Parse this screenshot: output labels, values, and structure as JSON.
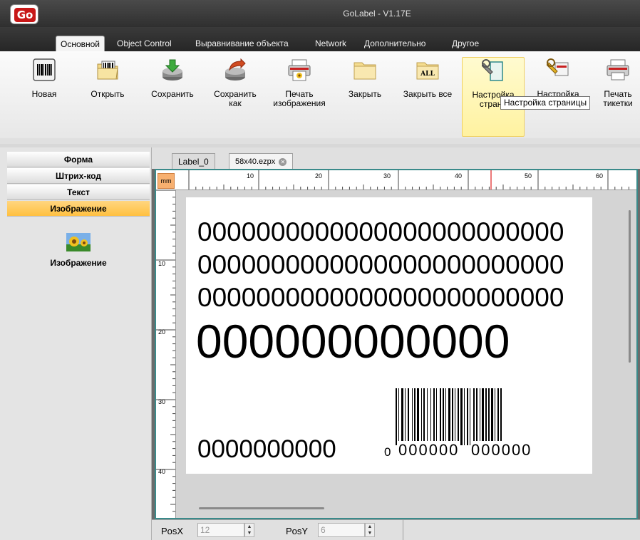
{
  "app": {
    "title": "GoLabel - V1.17E",
    "logo_text": "Go"
  },
  "ribbon_tabs": [
    "Основной",
    "Object Control",
    "Выравнивание объекта",
    "Network",
    "Дополнительно",
    "Другое"
  ],
  "ribbon_buttons": [
    {
      "label": "Новая",
      "icon": "barcode-doc-icon"
    },
    {
      "label": "Открыть",
      "icon": "open-folder-icon"
    },
    {
      "label": "Сохранить",
      "icon": "save-icon"
    },
    {
      "label": "Сохранить как",
      "icon": "save-as-icon"
    },
    {
      "label": "Печать изображения",
      "icon": "print-image-icon"
    },
    {
      "label": "Закрыть",
      "icon": "folder-icon"
    },
    {
      "label": "Закрыть все",
      "icon": "close-all-icon"
    },
    {
      "label": "Настройка страни",
      "icon": "page-setup-icon"
    },
    {
      "label": "Настройка",
      "icon": "settings-icon"
    },
    {
      "label": "Печать тикетки",
      "icon": "print-label-icon"
    }
  ],
  "tooltip": "Настройка страницы",
  "left_panel": {
    "sections": [
      "Форма",
      "Штрих-код",
      "Текст",
      "Изображение"
    ],
    "active_section": "Изображение",
    "item_label": "Изображение"
  },
  "doc_tabs": [
    "Label_0",
    "58x40.ezpx"
  ],
  "ruler": {
    "unit": "mm",
    "h_ticks": [
      "10",
      "20",
      "30",
      "40",
      "50",
      "60"
    ],
    "v_ticks": [
      "10",
      "20",
      "30",
      "40"
    ]
  },
  "label": {
    "line1": "0000000000000000000000000",
    "line2": "0000000000000000000000000",
    "line3": "0000000000000000000000000",
    "line4": "000000000000",
    "line5": "0000000000",
    "barcode_digits": [
      "0",
      "000000",
      "000000"
    ]
  },
  "status": {
    "posx_label": "PosX",
    "posx_value": "12",
    "posy_label": "PosY",
    "posy_value": "6"
  }
}
